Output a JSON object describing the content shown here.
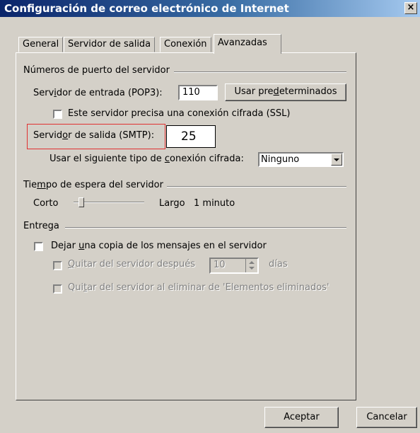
{
  "window": {
    "title": "Configuración de correo electrónico de Internet",
    "close_glyph": "×"
  },
  "tabs": [
    {
      "label": "General",
      "active": false
    },
    {
      "label": "Servidor de salida",
      "active": false
    },
    {
      "label": "Conexión",
      "active": false
    },
    {
      "label": "Avanzadas",
      "active": true
    }
  ],
  "ports": {
    "section_title": "Números de puerto del servidor",
    "incoming_label_pre": "Serv",
    "incoming_label_u": "i",
    "incoming_label_post": "dor de entrada (POP3):",
    "incoming_value": "110",
    "defaults_pre": "Usar pre",
    "defaults_u": "d",
    "defaults_post": "eterminados",
    "ssl_label": "Este servidor precisa una conexión cifrada (SSL)",
    "ssl_checked": false,
    "outgoing_label_pre": "Servid",
    "outgoing_label_u": "o",
    "outgoing_label_post": "r de salida (SMTP):",
    "outgoing_value": "25",
    "encryption_label_pre": "Usar el siguiente tipo de ",
    "encryption_label_u": "c",
    "encryption_label_post": "onexión cifrada:",
    "encryption_value": "Ninguno"
  },
  "timeout": {
    "section_title_pre": "Tie",
    "section_title_u": "m",
    "section_title_post": "po de espera del servidor",
    "short_label": "Corto",
    "long_label": "Largo",
    "value_text": "1 minuto",
    "slider_level": 0.1
  },
  "delivery": {
    "section_title": "Entrega",
    "leave_copy_pre": "Dejar ",
    "leave_copy_u": "u",
    "leave_copy_post": "na copia de los mensajes en el servidor",
    "leave_copy_checked": false,
    "remove_after_pre": "",
    "remove_after_u": "Q",
    "remove_after_post": "uitar del servidor después",
    "remove_after_days": "10",
    "days_label": "días",
    "remove_deleted_pre": "Qui",
    "remove_deleted_u": "t",
    "remove_deleted_post": "ar del servidor al eliminar de 'Elementos eliminados'"
  },
  "buttons": {
    "ok": "Aceptar",
    "cancel": "Cancelar"
  }
}
